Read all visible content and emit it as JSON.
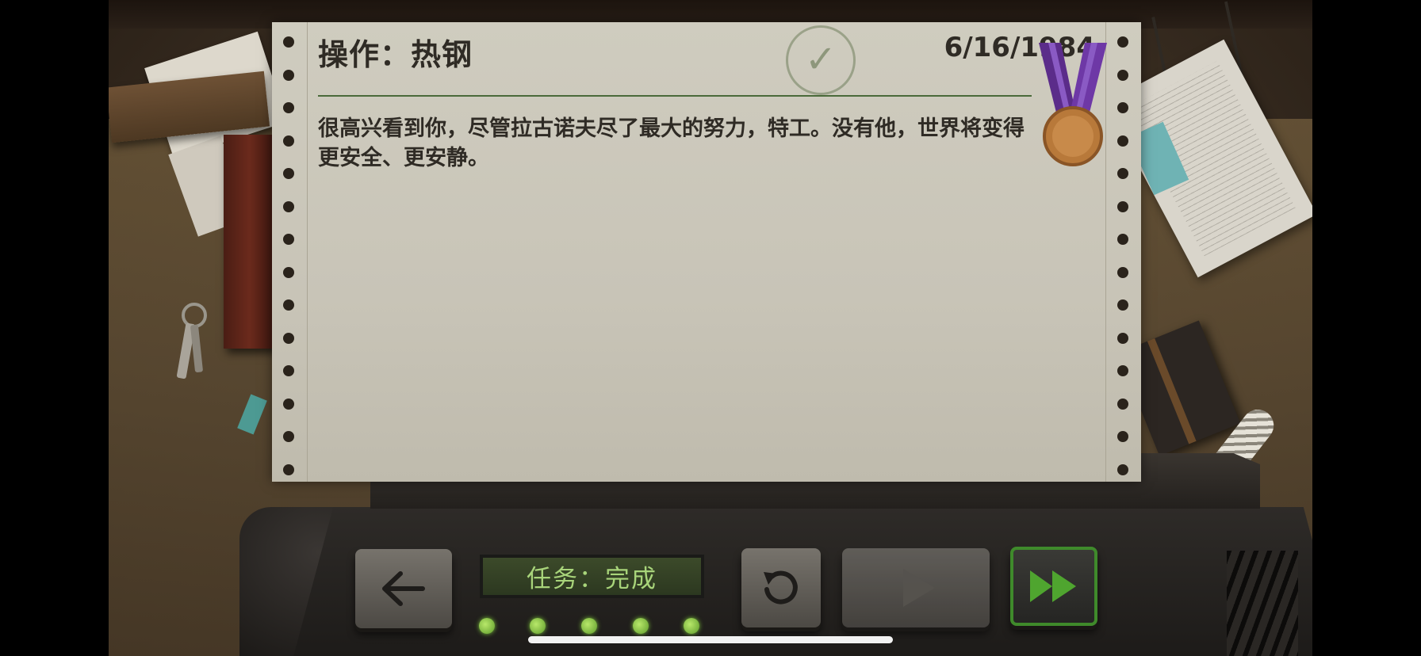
{
  "briefing": {
    "title": "操作：热钢",
    "date": "6/16/1984",
    "message": "很高兴看到你，尽管拉古诺夫尽了最大的努力，特工。没有他，世界将变得更安全、更安静。",
    "stamp_icon": "checkmark-stamp-icon",
    "medal": "bronze-medal-icon"
  },
  "console": {
    "status_text": "任务：完成",
    "back_icon": "arrow-left-icon",
    "restart_icon": "restart-icon",
    "play_icon": "play-icon",
    "fast_forward_icon": "fast-forward-icon",
    "progress_leds": 5
  },
  "colors": {
    "accent_green": "#3f8a2b",
    "status_text": "#a8d47a",
    "medal_ribbon": "#5b2c8a",
    "medal_bronze": "#b8793a"
  }
}
